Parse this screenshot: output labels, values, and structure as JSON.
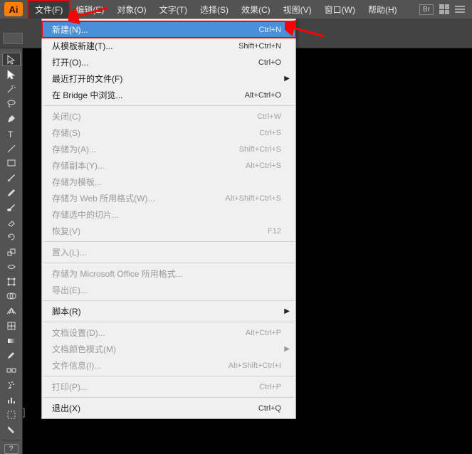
{
  "app": {
    "abbr": "Ai",
    "br": "Br"
  },
  "menubar": [
    "文件(F)",
    "编辑(E)",
    "对象(O)",
    "文字(T)",
    "选择(S)",
    "效果(C)",
    "视图(V)",
    "窗口(W)",
    "帮助(H)"
  ],
  "activeMenuIndex": 0,
  "dropdown": [
    {
      "label": "新建(N)...",
      "shortcut": "Ctrl+N",
      "hl": true
    },
    {
      "label": "从模板新建(T)...",
      "shortcut": "Shift+Ctrl+N"
    },
    {
      "label": "打开(O)...",
      "shortcut": "Ctrl+O"
    },
    {
      "label": "最近打开的文件(F)",
      "sub": true
    },
    {
      "label": "在 Bridge 中浏览...",
      "shortcut": "Alt+Ctrl+O"
    },
    {
      "sep": true
    },
    {
      "label": "关闭(C)",
      "shortcut": "Ctrl+W",
      "disabled": true
    },
    {
      "label": "存储(S)",
      "shortcut": "Ctrl+S",
      "disabled": true
    },
    {
      "label": "存储为(A)...",
      "shortcut": "Shift+Ctrl+S",
      "disabled": true
    },
    {
      "label": "存储副本(Y)...",
      "shortcut": "Alt+Ctrl+S",
      "disabled": true
    },
    {
      "label": "存储为模板...",
      "disabled": true
    },
    {
      "label": "存储为 Web 所用格式(W)...",
      "shortcut": "Alt+Shift+Ctrl+S",
      "disabled": true
    },
    {
      "label": "存储选中的切片...",
      "disabled": true
    },
    {
      "label": "恢复(V)",
      "shortcut": "F12",
      "disabled": true
    },
    {
      "sep": true
    },
    {
      "label": "置入(L)...",
      "disabled": true
    },
    {
      "sep": true
    },
    {
      "label": "存储为 Microsoft Office 所用格式...",
      "disabled": true
    },
    {
      "label": "导出(E)...",
      "disabled": true
    },
    {
      "sep": true
    },
    {
      "label": "脚本(R)",
      "sub": true
    },
    {
      "sep": true
    },
    {
      "label": "文档设置(D)...",
      "shortcut": "Alt+Ctrl+P",
      "disabled": true
    },
    {
      "label": "文档颜色模式(M)",
      "sub": true,
      "disabled": true
    },
    {
      "label": "文件信息(I)...",
      "shortcut": "Alt+Shift+Ctrl+I",
      "disabled": true
    },
    {
      "sep": true
    },
    {
      "label": "打印(P)...",
      "shortcut": "Ctrl+P",
      "disabled": true
    },
    {
      "sep": true
    },
    {
      "label": "退出(X)",
      "shortcut": "Ctrl+Q"
    }
  ],
  "qmark": "?"
}
